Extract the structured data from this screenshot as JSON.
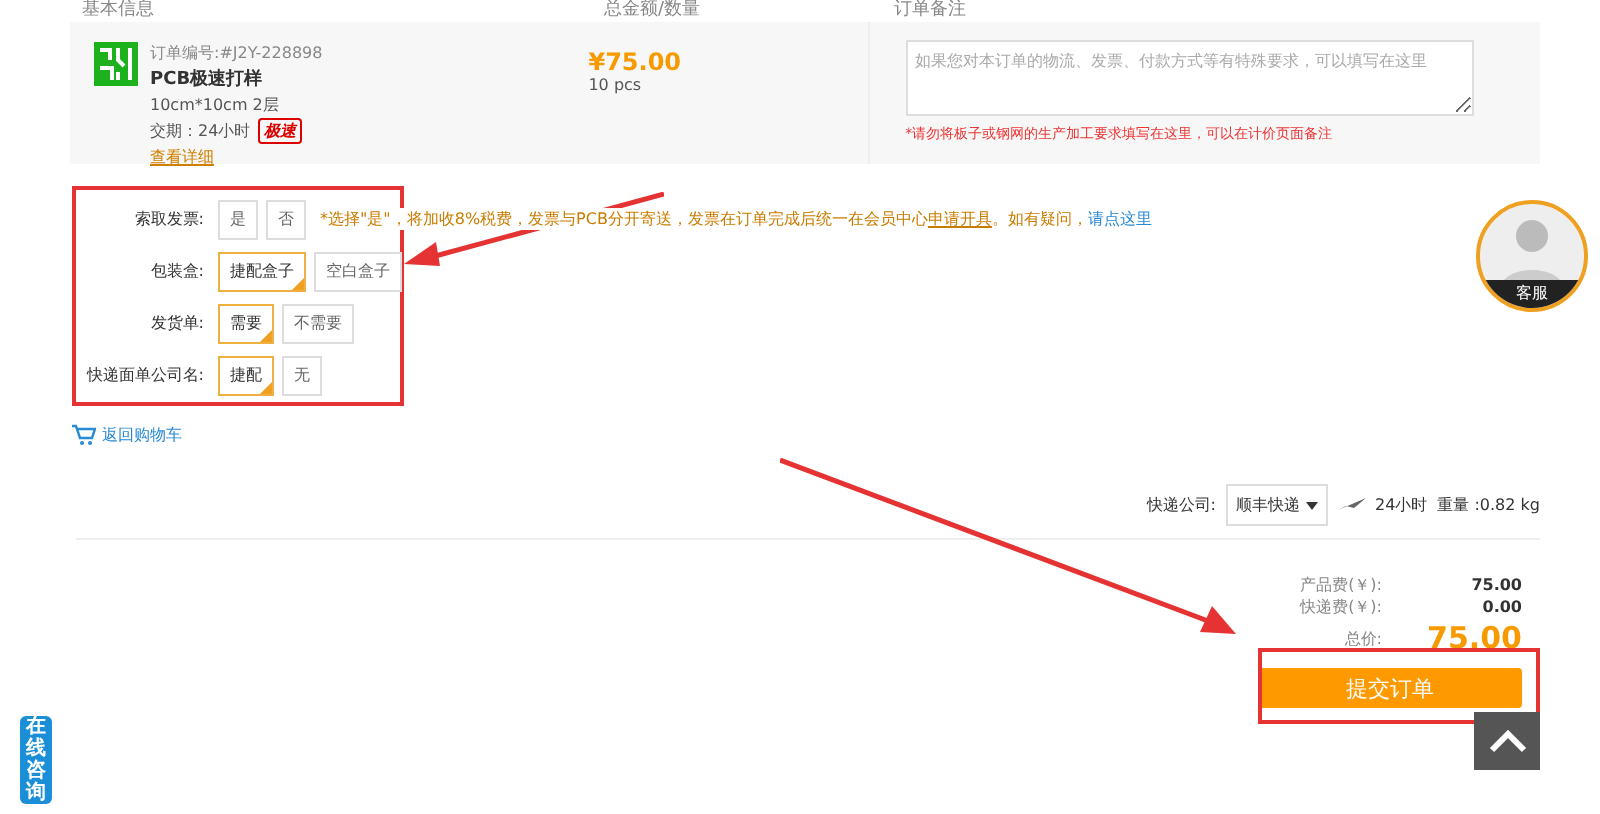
{
  "header": {
    "columns": [
      "基本信息",
      "总金额/数量",
      "订单备注"
    ]
  },
  "product": {
    "order_no": "订单编号:#J2Y-228898",
    "name": "PCB极速打样",
    "spec": "10cm*10cm 2层",
    "lead_time": "交期：24小时",
    "badge": "极速",
    "details_link": "查看详细",
    "price": "¥75.00",
    "quantity": "10 pcs",
    "remark_placeholder": "如果您对本订单的物流、发票、付款方式等有特殊要求，可以填写在这里",
    "remark_note": "*请勿将板子或钢网的生产加工要求填写在这里，可以在计价页面备注"
  },
  "options": [
    {
      "label": "索取发票:",
      "choices": [
        {
          "text": "是",
          "selected": false
        },
        {
          "text": "否",
          "selected": false
        }
      ],
      "note": "*选择\"是\"，将加收8%税费，发票与PCB分开寄送，发票在订单完成后统一在会员中心",
      "note_link": "申请开具",
      "note_tail": "。如有疑问，",
      "help_link": "请点这里"
    },
    {
      "label": "包装盒:",
      "choices": [
        {
          "text": "捷配盒子",
          "selected": true
        },
        {
          "text": "空白盒子",
          "selected": false
        }
      ]
    },
    {
      "label": "发货单:",
      "choices": [
        {
          "text": "需要",
          "selected": true
        },
        {
          "text": "不需要",
          "selected": false
        }
      ]
    },
    {
      "label": "快递面单公司名:",
      "choices": [
        {
          "text": "捷配",
          "selected": true
        },
        {
          "text": "无",
          "selected": false
        }
      ]
    }
  ],
  "back_to_cart": "返回购物车",
  "shipping": {
    "label": "快递公司:",
    "carrier": "顺丰快递",
    "time": "24小时",
    "weight": "重量 :0.82 kg"
  },
  "summary": [
    {
      "label": "产品费(￥):",
      "value": "75.00",
      "kind": "line"
    },
    {
      "label": "快递费(￥):",
      "value": "0.00",
      "kind": "line"
    },
    {
      "label": "总价:",
      "value": "75.00",
      "kind": "total"
    }
  ],
  "submit": "提交订单",
  "service_avatar": {
    "label": "客服"
  },
  "online_chat": "在线咨询"
}
